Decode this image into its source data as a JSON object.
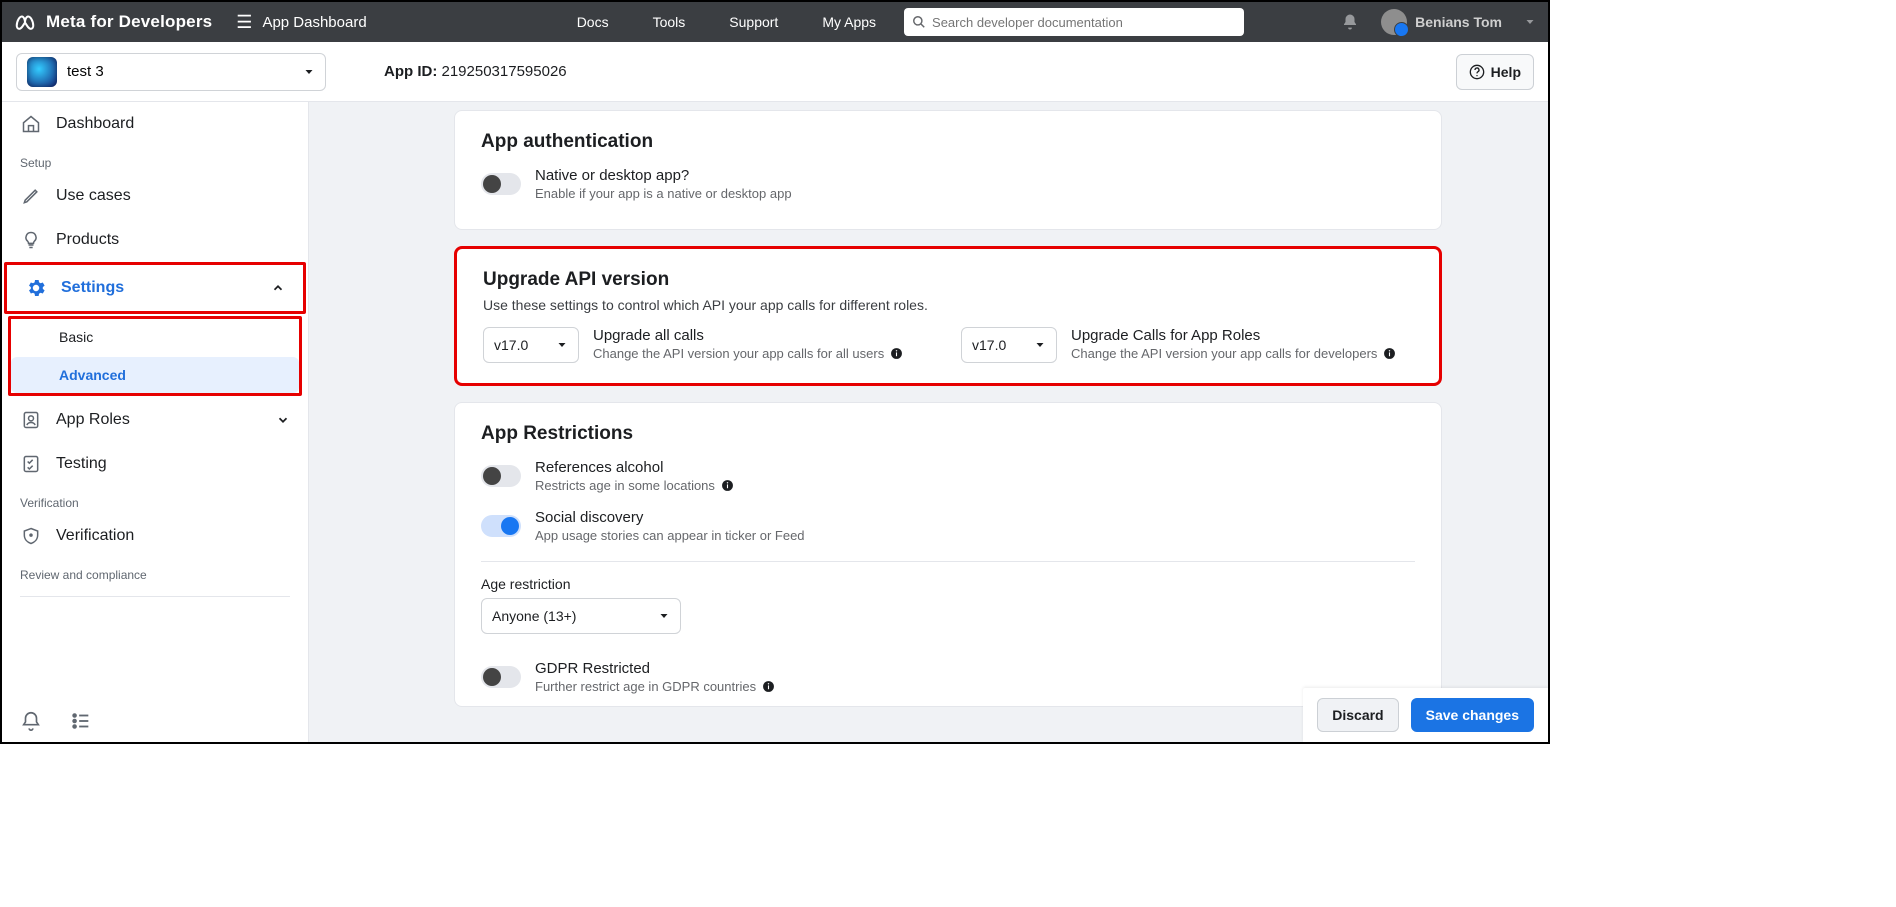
{
  "top": {
    "brand": "Meta for Developers",
    "page": "App Dashboard",
    "nav": {
      "docs": "Docs",
      "tools": "Tools",
      "support": "Support",
      "myapps": "My Apps"
    },
    "search_placeholder": "Search developer documentation",
    "username": "Benians Tom"
  },
  "app": {
    "selector_name": "test 3",
    "id_label": "App ID:",
    "id_value": "219250317595026",
    "help": "Help"
  },
  "sidebar": {
    "dashboard": "Dashboard",
    "setup_label": "Setup",
    "use_cases": "Use cases",
    "products": "Products",
    "settings": "Settings",
    "settings_basic": "Basic",
    "settings_advanced": "Advanced",
    "app_roles": "App Roles",
    "testing": "Testing",
    "verification_label": "Verification",
    "verification": "Verification",
    "review_label": "Review and compliance"
  },
  "auth": {
    "heading": "App authentication",
    "native_title": "Native or desktop app?",
    "native_desc": "Enable if your app is a native or desktop app"
  },
  "upgrade": {
    "heading": "Upgrade API version",
    "subtitle": "Use these settings to control which API your app calls for different roles.",
    "version1": "v17.0",
    "col1_title": "Upgrade all calls",
    "col1_desc": "Change the API version your app calls for all users",
    "version2": "v17.0",
    "col2_title": "Upgrade Calls for App Roles",
    "col2_desc": "Change the API version your app calls for developers"
  },
  "restrict": {
    "heading": "App Restrictions",
    "alcohol_title": "References alcohol",
    "alcohol_desc": "Restricts age in some locations",
    "social_title": "Social discovery",
    "social_desc": "App usage stories can appear in ticker or Feed",
    "age_label": "Age restriction",
    "age_value": "Anyone (13+)",
    "gdpr_title": "GDPR Restricted",
    "gdpr_desc": "Further restrict age in GDPR countries"
  },
  "footer": {
    "discard": "Discard",
    "save": "Save changes"
  }
}
